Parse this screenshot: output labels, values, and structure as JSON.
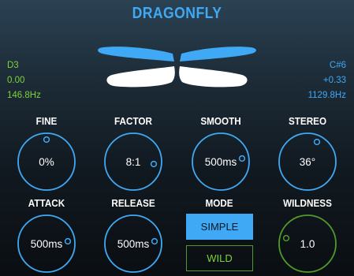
{
  "title": "DRAGONFLY",
  "colors": {
    "accent_blue": "#3fa9f5",
    "accent_green": "#7dd33a",
    "wing_white": "#ffffff",
    "background": "#111920"
  },
  "readout_left": {
    "note": "D3",
    "cents": "0.00",
    "freq": "146.8Hz"
  },
  "readout_right": {
    "note": "C#6",
    "cents": "+0.33",
    "freq": "1129.8Hz"
  },
  "knobs": {
    "fine": {
      "label": "FINE",
      "value": "0%",
      "color": "#3fa9f5"
    },
    "factor": {
      "label": "FACTOR",
      "value": "8:1",
      "color": "#3fa9f5"
    },
    "smooth": {
      "label": "SMOOTH",
      "value": "500ms",
      "color": "#3fa9f5"
    },
    "stereo": {
      "label": "STEREO",
      "value": "36°",
      "color": "#3fa9f5"
    },
    "attack": {
      "label": "ATTACK",
      "value": "500ms",
      "color": "#3fa9f5"
    },
    "release": {
      "label": "RELEASE",
      "value": "500ms",
      "color": "#3fa9f5"
    },
    "wildness": {
      "label": "WILDNESS",
      "value": "1.0",
      "color": "#4f9a2a"
    }
  },
  "mode": {
    "label": "MODE",
    "options": [
      "SIMPLE",
      "WILD"
    ],
    "selected": "SIMPLE"
  }
}
